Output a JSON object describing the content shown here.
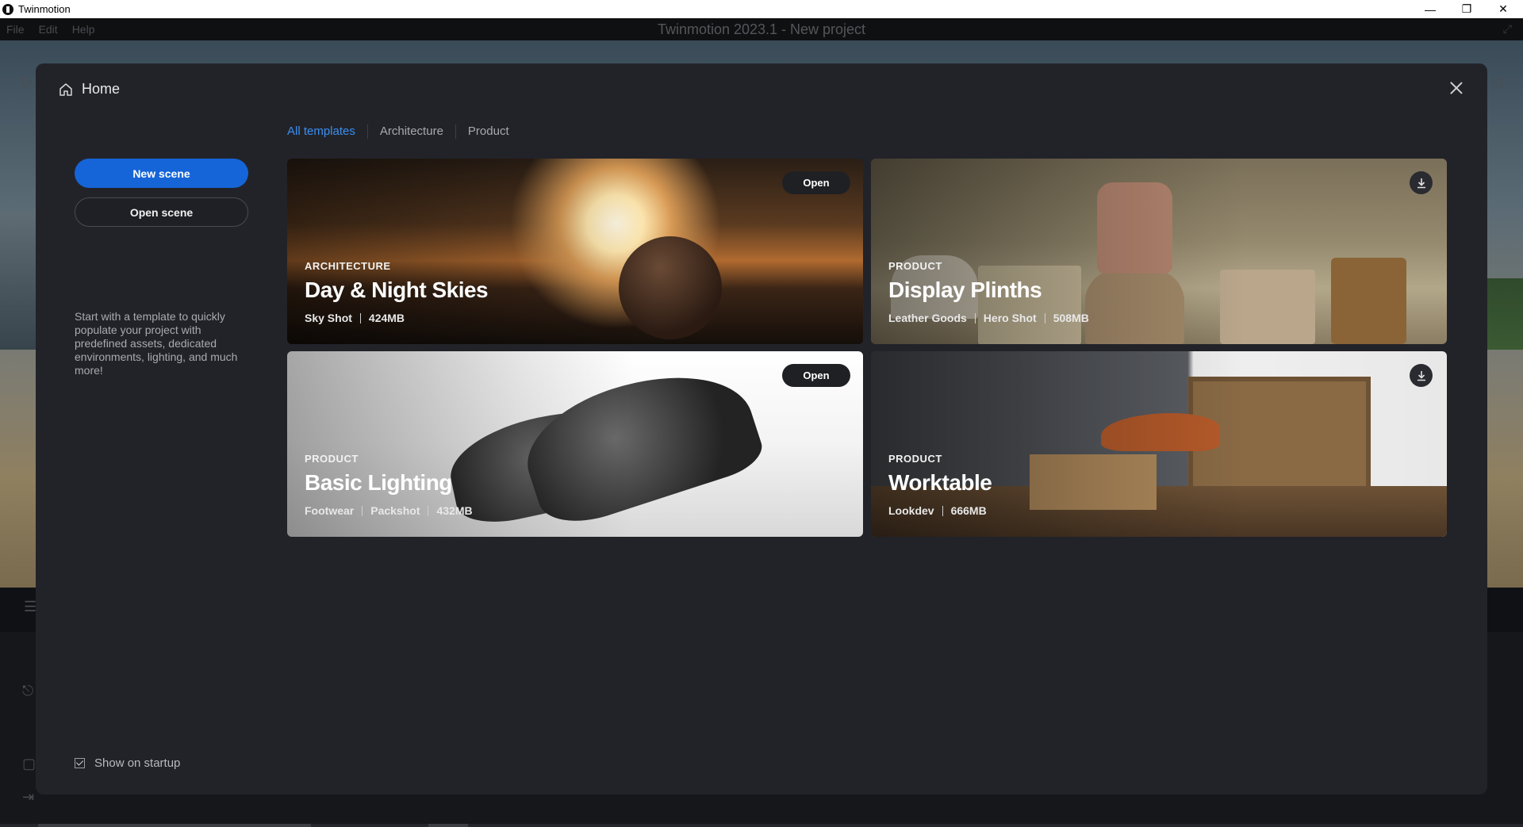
{
  "titlebar": {
    "app_name": "Twinmotion"
  },
  "menubar": {
    "items": [
      "File",
      "Edit",
      "Help"
    ],
    "title": "Twinmotion 2023.1 - New project"
  },
  "modal": {
    "title": "Home",
    "new_scene_label": "New scene",
    "open_scene_label": "Open scene",
    "intro_text": "Start with a template to quickly populate your project with predefined assets, dedicated environments, lighting, and much more!",
    "show_on_startup_label": "Show on startup",
    "show_on_startup_checked": true,
    "tabs": [
      "All templates",
      "Architecture",
      "Product"
    ],
    "active_tab": "All templates",
    "templates": [
      {
        "category": "ARCHITECTURE",
        "name": "Day & Night Skies",
        "tags": [
          "Sky Shot"
        ],
        "size": "424MB",
        "action": "Open"
      },
      {
        "category": "PRODUCT",
        "name": "Display Plinths",
        "tags": [
          "Leather Goods",
          "Hero Shot"
        ],
        "size": "508MB",
        "action": "download"
      },
      {
        "category": "PRODUCT",
        "name": "Basic Lighting",
        "tags": [
          "Footwear",
          "Packshot"
        ],
        "size": "432MB",
        "action": "Open"
      },
      {
        "category": "PRODUCT",
        "name": "Worktable",
        "tags": [
          "Lookdev"
        ],
        "size": "666MB",
        "action": "download"
      }
    ]
  },
  "colors": {
    "accent": "#1565d8",
    "active_tab": "#3a8ff0",
    "modal_bg": "#222329"
  },
  "icons": {
    "home": "home-icon",
    "close": "close-icon",
    "download": "download-icon",
    "checkbox": "checkbox-checked-icon"
  }
}
